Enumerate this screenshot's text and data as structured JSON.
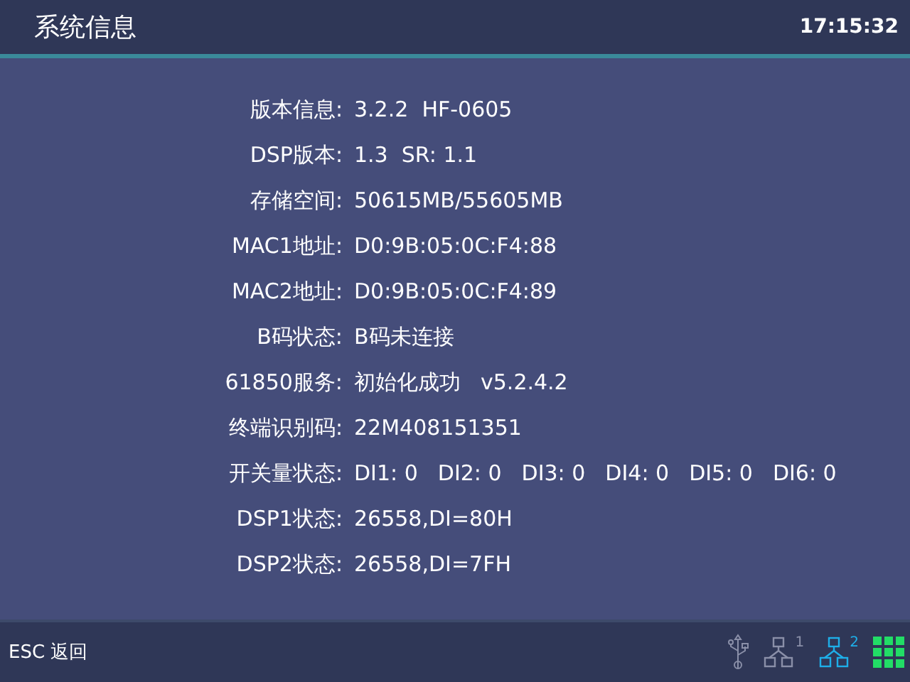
{
  "header": {
    "title": "系统信息",
    "time": "17:15:32"
  },
  "info_rows": [
    {
      "label": "版本信息:",
      "values": [
        "3.2.2  HF-0605"
      ]
    },
    {
      "label": "DSP版本:",
      "values": [
        "1.3  SR: 1.1"
      ]
    },
    {
      "label": "存储空间:",
      "values": [
        "50615MB/55605MB"
      ]
    },
    {
      "label": "MAC1地址:",
      "values": [
        "D0:9B:05:0C:F4:88"
      ]
    },
    {
      "label": "MAC2地址:",
      "values": [
        "D0:9B:05:0C:F4:89"
      ]
    },
    {
      "label": "B码状态:",
      "values": [
        "B码未连接"
      ]
    },
    {
      "label": "61850服务:",
      "values": [
        "初始化成功",
        "v5.2.4.2"
      ]
    },
    {
      "label": "终端识别码:",
      "values": [
        "22M408151351"
      ]
    },
    {
      "label": "开关量状态:",
      "values": [
        "DI1: 0",
        "DI2: 0",
        "DI3: 0",
        "DI4: 0",
        "DI5: 0",
        "DI6: 0"
      ]
    },
    {
      "label": "DSP1状态:",
      "values": [
        "26558,DI=80H"
      ]
    },
    {
      "label": "DSP2状态:",
      "values": [
        "26558,DI=7FH"
      ]
    }
  ],
  "footer": {
    "hint": "ESC 返回",
    "status_icons": [
      {
        "kind": "usb",
        "active": false
      },
      {
        "kind": "network",
        "label": "1",
        "active": false
      },
      {
        "kind": "network",
        "label": "2",
        "active": true
      },
      {
        "kind": "grid",
        "active": true
      }
    ]
  }
}
